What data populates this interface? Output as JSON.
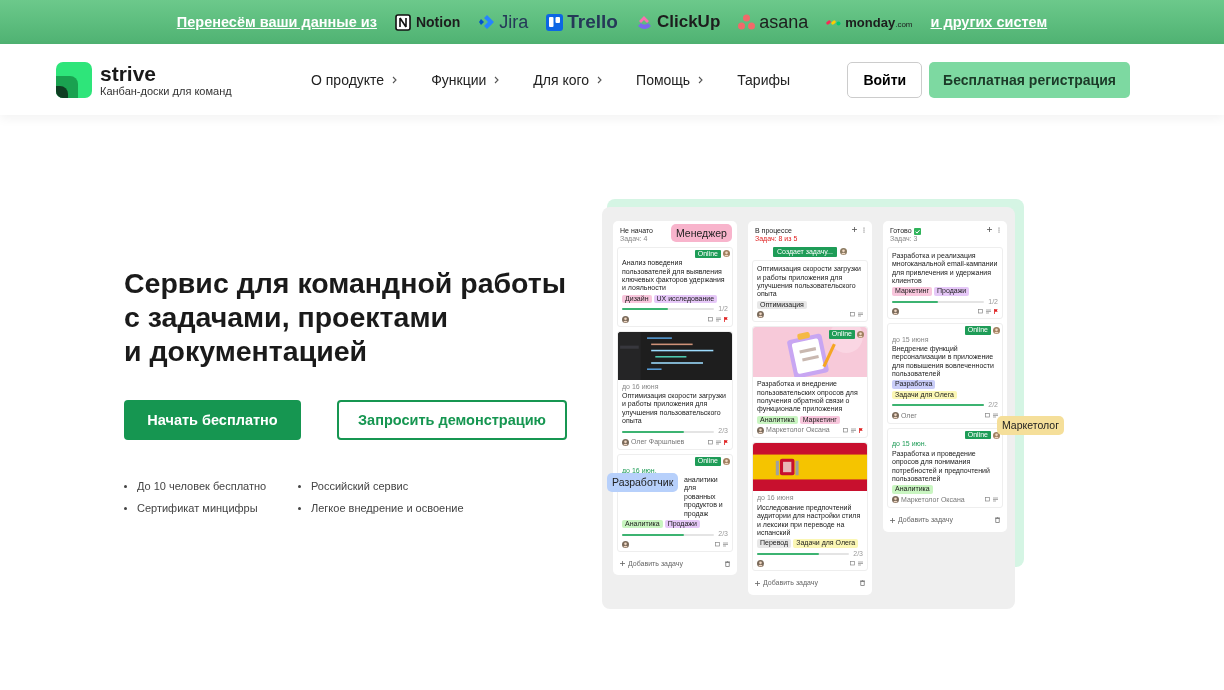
{
  "banner": {
    "lead": "Перенесём ваши данные из",
    "logos": [
      {
        "kind": "notion",
        "name": "Notion"
      },
      {
        "kind": "jira",
        "name": "Jira"
      },
      {
        "kind": "trello",
        "name": "Trello"
      },
      {
        "kind": "clickup",
        "name": "ClickUp"
      },
      {
        "kind": "asana",
        "name": "asana"
      },
      {
        "kind": "monday",
        "name": "monday",
        "suffix": ".com"
      }
    ],
    "tail": "и других систем"
  },
  "header": {
    "brand": "strive",
    "tagline": "Канбан-доски для команд",
    "nav": [
      {
        "label": "О продукте",
        "submenu": true
      },
      {
        "label": "Функции",
        "submenu": true
      },
      {
        "label": "Для кого",
        "submenu": true
      },
      {
        "label": "Помощь",
        "submenu": true
      },
      {
        "label": "Тарифы",
        "submenu": false
      }
    ],
    "login": "Войти",
    "signup": "Бесплатная регистрация"
  },
  "hero": {
    "title": "Сервис для командной работы\nс задачами, проектами\nи документацией",
    "primary": "Начать бесплатно",
    "secondary": "Запросить демонстрацию",
    "features": [
      "До 10 человек бесплатно",
      "Сертификат минцифры",
      "Российский сервис",
      "Легкое внедрение и освоение"
    ]
  },
  "board": {
    "columns": [
      {
        "title": "Не начато",
        "count": "Задач: 4",
        "over_limit": false,
        "done": false,
        "actions": false,
        "add": "Добавить задачу",
        "cards": [
          {
            "kind": "text",
            "online": "Online",
            "title": "Анализ поведения пользователей для выявления ключевых факторов удержания и лояльности",
            "tags": [
              {
                "label": "Дизайн",
                "color": "#f8c6dc"
              },
              {
                "label": "UX исследование",
                "color": "#e6c8f8"
              }
            ],
            "level": 0.5,
            "progress": "1/2",
            "flagged": true
          },
          {
            "kind": "picture",
            "due": "до 16 июня",
            "due_soon": false,
            "title": "Оптимизация скорости загрузки и работы приложения для улучшения пользовательского опыта",
            "level": 0.67,
            "progress": "2/3",
            "assignee": "Олег Фаршлыев",
            "flagged": true
          },
          {
            "kind": "covered",
            "online": "Online",
            "due": "до 16 июн.",
            "due_soon": true,
            "title": "аналитики для рованных продуктов и продаж",
            "tags": [
              {
                "label": "Аналитика",
                "color": "#c9f5c1"
              },
              {
                "label": "Продажи",
                "color": "#e6c8f8"
              }
            ],
            "level": 0.67,
            "progress": "2/3",
            "flagged": false
          }
        ]
      },
      {
        "title": "В процессе",
        "count": "Задач: 8 из 5",
        "over_limit": true,
        "done": false,
        "actions": true,
        "activity": "Создает задачу...",
        "add": "Добавить задачу",
        "cards": [
          {
            "kind": "text",
            "title": "Оптимизация скорости загрузки и работы приложения для улучшения пользовательского опыта",
            "tags": [
              {
                "label": "Оптимизация",
                "color": "#e8e8e8"
              }
            ],
            "flagged": false
          },
          {
            "kind": "picture",
            "online": "Online",
            "title": "Разработка и внедрение пользовательских опросов для получения обратной связи о функционале приложения",
            "tags": [
              {
                "label": "Аналитика",
                "color": "#c9f5c1"
              },
              {
                "label": "Маркетинг",
                "color": "#f8c6dc"
              }
            ],
            "assignee": "Маркетолог Оксана",
            "flagged": true
          },
          {
            "kind": "picture",
            "due": "до 16 июня",
            "due_soon": false,
            "title": "Исследование предпочтений аудитории для настройки стиля и лексики при переводе на испанский",
            "tags": [
              {
                "label": "Перевод",
                "color": "#e8e8e8"
              },
              {
                "label": "Задачи для Олега",
                "color": "#fbf7b4"
              }
            ],
            "level": 0.67,
            "progress": "2/3",
            "flagged": false
          }
        ]
      },
      {
        "title": "Готово",
        "count": "Задач: 3",
        "over_limit": false,
        "done": true,
        "actions": true,
        "add": "Добавить задачу",
        "cards": [
          {
            "kind": "text",
            "title": "Разработка и реализация многоканальной email-кампании для привлечения и удержания клиентов",
            "tags": [
              {
                "label": "Маркетинг",
                "color": "#f8c6dc"
              },
              {
                "label": "Продажи",
                "color": "#e6c8f8"
              }
            ],
            "level": 0.5,
            "progress": "1/2",
            "flagged": true
          },
          {
            "kind": "text",
            "online": "Online",
            "due": "до 15 июня",
            "due_soon": false,
            "title": "Внедрение функций персонализации в приложение для повышения вовлеченности пользователей",
            "tags": [
              {
                "label": "Разработка",
                "color": "#c9cdf8"
              },
              {
                "label": "Задачи для Олега",
                "color": "#fbf7b4"
              }
            ],
            "level": 1,
            "progress": "2/2",
            "assignee": "Олег",
            "flagged": false
          },
          {
            "kind": "text",
            "online": "Online",
            "due": "до 15 июн.",
            "due_soon": true,
            "title": "Разработка и проведение опросов для понимания потребностей и предпочтений пользователей",
            "tags": [
              {
                "label": "Аналитика",
                "color": "#c9f5c1"
              }
            ],
            "assignee": "Маркетолог Оксана",
            "flagged": false
          }
        ]
      }
    ],
    "roles": [
      {
        "label": "Менеджер",
        "color": "#f8b4cc"
      },
      {
        "label": "Разработчик",
        "color": "#b7d0fb"
      },
      {
        "label": "Маркетолог",
        "color": "#f5df9a"
      }
    ]
  }
}
